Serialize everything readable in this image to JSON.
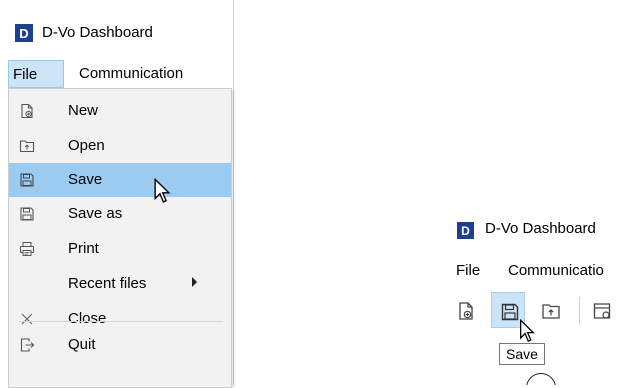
{
  "window_left": {
    "logo_letter": "D",
    "title": "D-Vo Dashboard",
    "menubar": {
      "file": "File",
      "communication": "Communication"
    },
    "file_menu": {
      "items": [
        {
          "label": "New",
          "icon": "new-file-icon"
        },
        {
          "label": "Open",
          "icon": "open-folder-icon"
        },
        {
          "label": "Save",
          "icon": "save-icon",
          "highlighted": true
        },
        {
          "label": "Save as",
          "icon": "save-as-icon"
        },
        {
          "label": "Print",
          "icon": "printer-icon"
        },
        {
          "label": "Recent files",
          "icon": "submenu-arrow-icon"
        },
        {
          "label": "Close",
          "icon": "close-icon"
        },
        {
          "label": "Quit",
          "icon": "quit-icon"
        }
      ]
    }
  },
  "window_right": {
    "logo_letter": "D",
    "title": "D-Vo Dashboard",
    "menubar": {
      "file": "File",
      "communication": "Communicatio"
    },
    "toolbar": {
      "buttons": [
        {
          "icon": "new-file-icon"
        },
        {
          "icon": "save-icon",
          "pressed": true
        },
        {
          "icon": "open-folder-icon"
        },
        {
          "icon": "save-as-icon"
        }
      ],
      "tooltip": "Save"
    }
  },
  "colors": {
    "menu_highlight": "#9ccbf2",
    "menu_background": "#f2f2f2",
    "logo_background": "#1f3f8f",
    "pressed_button": "#cce4f7"
  }
}
